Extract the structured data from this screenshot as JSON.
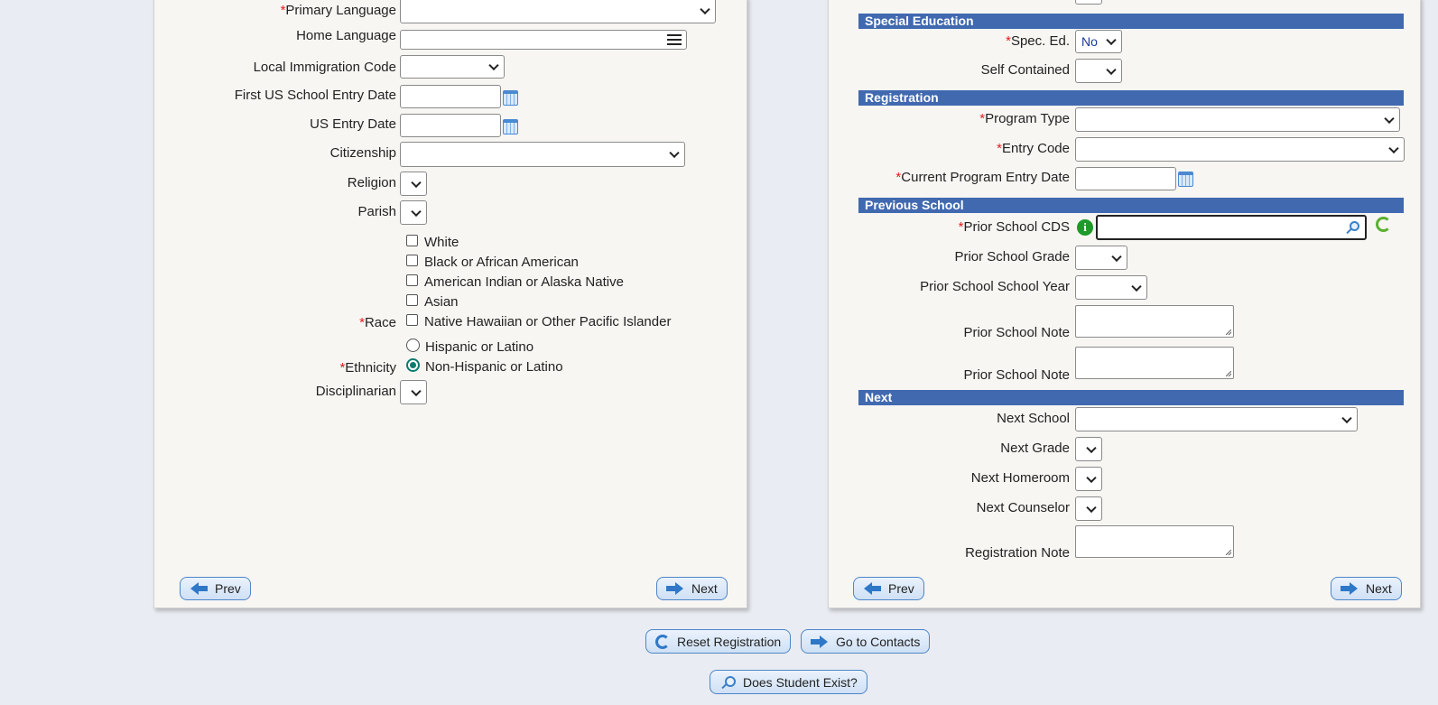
{
  "left": {
    "primary_language": {
      "label": "Primary Language",
      "value": ""
    },
    "home_language": {
      "label": "Home Language",
      "value": ""
    },
    "local_immigration_code": {
      "label": "Local Immigration Code",
      "value": ""
    },
    "first_us_school_entry_date": {
      "label": "First US School Entry Date",
      "value": ""
    },
    "us_entry_date": {
      "label": "US Entry Date",
      "value": ""
    },
    "citizenship": {
      "label": "Citizenship",
      "value": ""
    },
    "religion": {
      "label": "Religion",
      "value": ""
    },
    "parish": {
      "label": "Parish",
      "value": ""
    },
    "race": {
      "label": "Race",
      "options": [
        "White",
        "Black or African American",
        "American Indian or Alaska Native",
        "Asian",
        "Native Hawaiian or Other Pacific Islander"
      ],
      "checked": [
        false,
        false,
        false,
        false,
        false
      ]
    },
    "ethnicity": {
      "label": "Ethnicity",
      "options": [
        "Hispanic or Latino",
        "Non-Hispanic or Latino"
      ],
      "selected": "Non-Hispanic or Latino"
    },
    "disciplinarian": {
      "label": "Disciplinarian",
      "value": ""
    },
    "prev_label": "Prev",
    "next_label": "Next"
  },
  "right": {
    "special_education": {
      "header": "Special Education",
      "spec_ed": {
        "label": "Spec. Ed.",
        "value": "No"
      },
      "self_contained": {
        "label": "Self Contained",
        "value": ""
      }
    },
    "registration": {
      "header": "Registration",
      "program_type": {
        "label": "Program Type",
        "value": ""
      },
      "entry_code": {
        "label": "Entry Code",
        "value": ""
      },
      "current_program_entry_date": {
        "label": "Current Program Entry Date",
        "value": ""
      }
    },
    "previous_school": {
      "header": "Previous School",
      "prior_school_cds": {
        "label": "Prior School CDS",
        "value": ""
      },
      "prior_school_grade": {
        "label": "Prior School Grade",
        "value": ""
      },
      "prior_school_school_year": {
        "label": "Prior School School Year",
        "value": ""
      },
      "prior_school_note_1": {
        "label": "Prior School Note",
        "value": ""
      },
      "prior_school_note_2": {
        "label": "Prior School Note",
        "value": ""
      }
    },
    "next": {
      "header": "Next",
      "next_school": {
        "label": "Next School",
        "value": ""
      },
      "next_grade": {
        "label": "Next Grade",
        "value": ""
      },
      "next_homeroom": {
        "label": "Next Homeroom",
        "value": ""
      },
      "next_counselor": {
        "label": "Next Counselor",
        "value": ""
      },
      "registration_note": {
        "label": "Registration Note",
        "value": ""
      }
    },
    "prev_label": "Prev",
    "next_label": "Next"
  },
  "footer": {
    "reset_registration": "Reset Registration",
    "go_to_contacts": "Go to Contacts",
    "does_student_exist": "Does Student Exist?"
  },
  "colors": {
    "section_header": "#4169b0",
    "required_asterisk": "#e8191c",
    "button_border": "#4e86c6",
    "radio_selected": "#0b7a6e"
  }
}
